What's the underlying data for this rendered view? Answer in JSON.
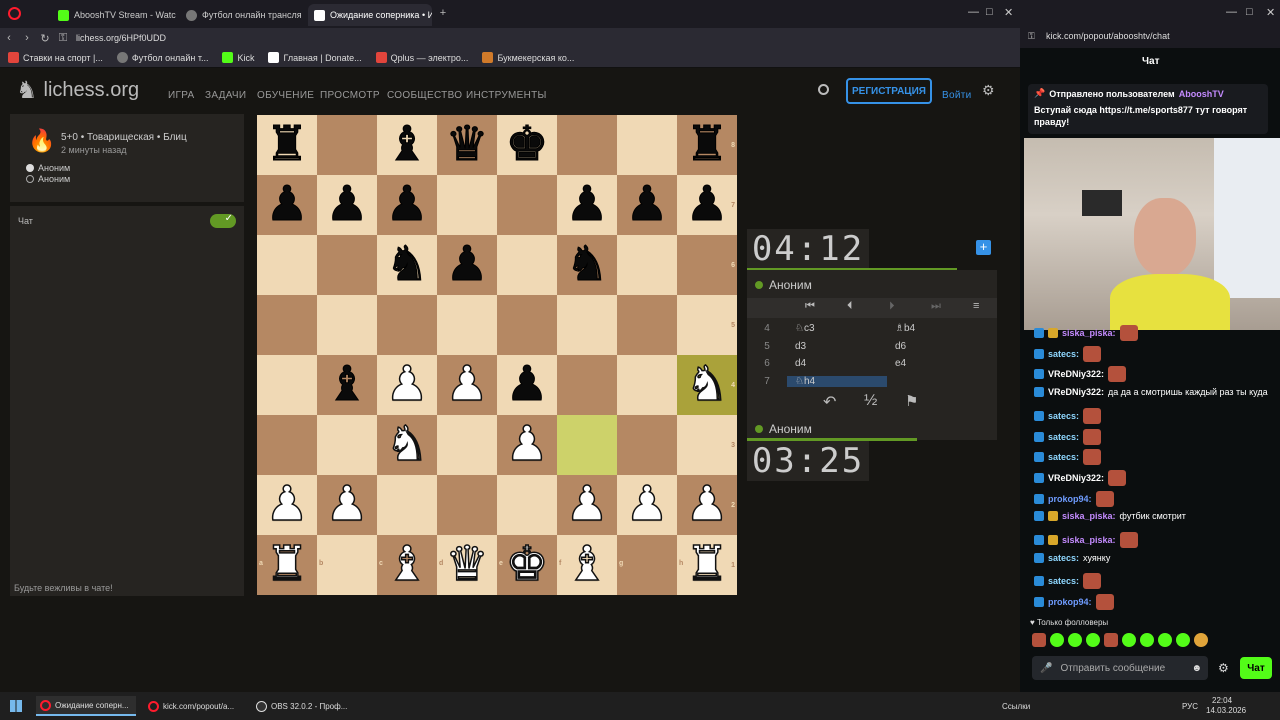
{
  "browser": {
    "tabs": [
      {
        "label": "AbooshTV Stream - Watc",
        "color": "#53fc18"
      },
      {
        "label": "Футбол онлайн трансля",
        "color": "#888888"
      },
      {
        "label": "Ожидание соперника • И",
        "color": "#ffffff",
        "active": true
      }
    ],
    "url": "lichess.org/6HPf0UDD",
    "bookmarks": [
      "Ставки на спорт |...",
      "Футбол онлайн т...",
      "Kick",
      "Главная | Donate...",
      "Qplus — электро...",
      "Букмекерская ко..."
    ]
  },
  "lichess": {
    "logo": "lichess.org",
    "nav": [
      "ИГРА",
      "ЗАДАЧИ",
      "ОБУЧЕНИЕ",
      "ПРОСМОТР",
      "СООБЩЕСТВО",
      "ИНСТРУМЕНТЫ"
    ],
    "register": "РЕГИСТРАЦИЯ",
    "login": "Войти",
    "game_info": "5+0 • Товарищеская • Блиц",
    "game_time": "2 минуты назад",
    "player1": "Аноним",
    "player2": "Аноним",
    "chat_label": "Чат",
    "chat_placeholder": "Будьте вежливы в чате!",
    "clock_top": "04:12",
    "clock_bottom": "03:25",
    "top_player": "Аноним",
    "bottom_player": "Аноним",
    "draw_symbol": "½",
    "moves": [
      {
        "n": "4",
        "w": "♘c3",
        "b": "♗b4"
      },
      {
        "n": "5",
        "w": "d3",
        "b": "d6"
      },
      {
        "n": "6",
        "w": "d4",
        "b": "e4"
      },
      {
        "n": "7",
        "w": "♘h4",
        "b": ""
      }
    ],
    "board": [
      [
        "br",
        "",
        "bb",
        "bq",
        "bk",
        "",
        "",
        "br"
      ],
      [
        "bp",
        "bp",
        "bp",
        "",
        "",
        "bp",
        "bp",
        "bp"
      ],
      [
        "",
        "",
        "bn",
        "bp",
        "",
        "bn",
        "",
        ""
      ],
      [
        "",
        "",
        "",
        "",
        "",
        "",
        "",
        ""
      ],
      [
        "",
        "bb",
        "wp",
        "wp",
        "bp",
        "",
        "",
        "wn"
      ],
      [
        "",
        "",
        "wn",
        "",
        "wp",
        "",
        "",
        ""
      ],
      [
        "wp",
        "wp",
        "",
        "",
        "",
        "wp",
        "wp",
        "wp"
      ],
      [
        "wr",
        "",
        "wb",
        "wq",
        "wk",
        "wb",
        "",
        "wr"
      ]
    ],
    "files": [
      "a",
      "b",
      "c",
      "d",
      "e",
      "f",
      "g",
      "h"
    ]
  },
  "kick": {
    "url": "kick.com/popout/abooshtv/chat",
    "title": "Чат",
    "pinned_by": "Отправлено пользователем",
    "pinned_user": "AbooshTV",
    "pinned_text": "Вступай сюда https://t.me/sports877 тут говорят правду!",
    "messages": [
      {
        "user": "siska_piska:",
        "text": "",
        "color": "#c48bff"
      },
      {
        "user": "satecs:",
        "text": "",
        "color": "#8fd7ff"
      },
      {
        "user": "VReDNiy322:",
        "text": "",
        "color": "#ffffff"
      },
      {
        "user": "VReDNiy322:",
        "text": "да да а смотришь каждый раз ты куда",
        "color": "#ffffff"
      },
      {
        "user": "satecs:",
        "text": "",
        "color": "#8fd7ff"
      },
      {
        "user": "satecs:",
        "text": "",
        "color": "#8fd7ff"
      },
      {
        "user": "satecs:",
        "text": "",
        "color": "#8fd7ff"
      },
      {
        "user": "VReDNiy322:",
        "text": "",
        "color": "#ffffff"
      },
      {
        "user": "prokop94:",
        "text": "",
        "color": "#6f9cff"
      },
      {
        "user": "siska_piska:",
        "text": "футбик смотрит",
        "color": "#c48bff"
      },
      {
        "user": "siska_piska:",
        "text": "",
        "color": "#c48bff"
      },
      {
        "user": "satecs:",
        "text": "хуянку",
        "color": "#8fd7ff"
      },
      {
        "user": "satecs:",
        "text": "",
        "color": "#8fd7ff"
      },
      {
        "user": "prokop94:",
        "text": "",
        "color": "#6f9cff"
      }
    ],
    "followers_only": "Только фолловеры",
    "input_placeholder": "Отправить сообщение",
    "send": "Чат"
  },
  "taskbar": {
    "items": [
      "Ожидание соперн...",
      "kick.com/popout/a...",
      "OBS 32.0.2 - Проф..."
    ],
    "links": "Ссылки",
    "lang": "РУС",
    "time": "22:04",
    "date": "14.03.2026"
  }
}
